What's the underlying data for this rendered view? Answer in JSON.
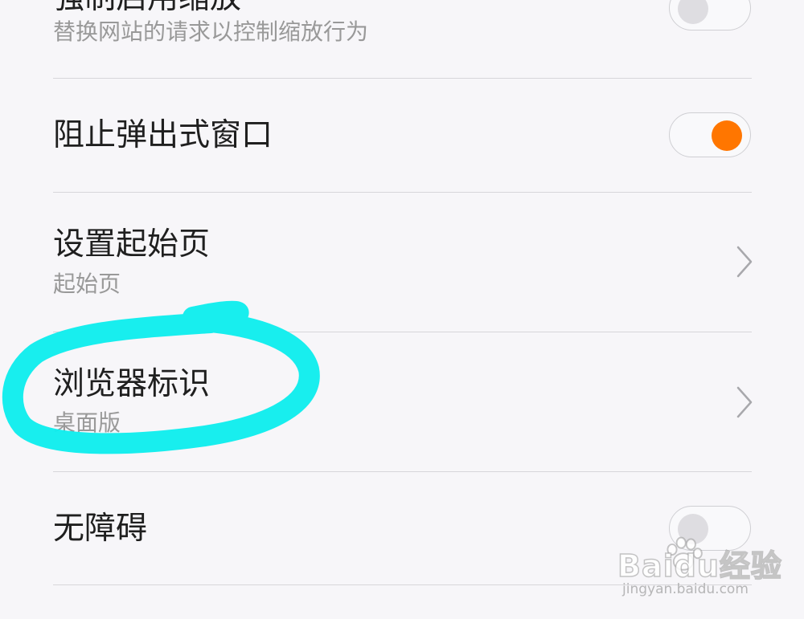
{
  "settings": {
    "items": [
      {
        "title": "强制启用缩放",
        "subtitle": "替换网站的请求以控制缩放行为",
        "control": "toggle",
        "state": "off"
      },
      {
        "title": "阻止弹出式窗口",
        "control": "toggle",
        "state": "on"
      },
      {
        "title": "设置起始页",
        "subtitle": "起始页",
        "control": "chevron-right-icon"
      },
      {
        "title": "浏览器标识",
        "subtitle": "桌面版",
        "control": "chevron-right-icon"
      },
      {
        "title": "无障碍",
        "control": "toggle",
        "state": "off"
      }
    ]
  },
  "watermark": {
    "brand": "Baidu经验",
    "url": "jingyan.baidu.com"
  },
  "colors": {
    "background": "#f7f6f9",
    "toggle_on": "#ff7600",
    "annotation_highlight": "#11eded",
    "text_primary": "#1f1f1f",
    "text_secondary": "#999999",
    "divider": "#d7d6da"
  }
}
